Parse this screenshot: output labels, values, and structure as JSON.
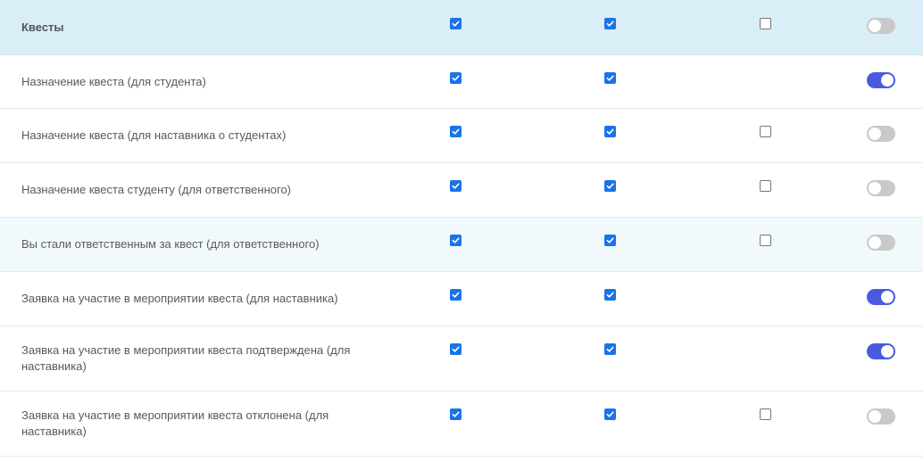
{
  "colors": {
    "checkbox_checked": "#1a73e8",
    "toggle_on": "#4a5ae0",
    "toggle_off": "#c9c9c9",
    "header_bg": "#daeef8",
    "highlight_bg": "#f2f9fd"
  },
  "rows": [
    {
      "label": "Квесты",
      "col1": true,
      "col2": true,
      "col3": false,
      "toggle": false,
      "kind": "header"
    },
    {
      "label": "Назначение квеста (для студента)",
      "col1": true,
      "col2": true,
      "col3": null,
      "toggle": true,
      "kind": "normal"
    },
    {
      "label": "Назначение квеста (для наставника о студентах)",
      "col1": true,
      "col2": true,
      "col3": false,
      "toggle": false,
      "kind": "normal"
    },
    {
      "label": "Назначение квеста студенту (для ответственного)",
      "col1": true,
      "col2": true,
      "col3": false,
      "toggle": false,
      "kind": "normal"
    },
    {
      "label": "Вы стали ответственным за квест (для ответственного)",
      "col1": true,
      "col2": true,
      "col3": false,
      "toggle": false,
      "kind": "highlight"
    },
    {
      "label": "Заявка на участие в мероприятии квеста (для наставника)",
      "col1": true,
      "col2": true,
      "col3": null,
      "toggle": true,
      "kind": "normal"
    },
    {
      "label": "Заявка на участие в мероприятии квеста подтверждена (для наставника)",
      "col1": true,
      "col2": true,
      "col3": null,
      "toggle": true,
      "kind": "normal"
    },
    {
      "label": "Заявка на участие в мероприятии квеста отклонена (для наставника)",
      "col1": true,
      "col2": true,
      "col3": false,
      "toggle": false,
      "kind": "normal"
    }
  ]
}
